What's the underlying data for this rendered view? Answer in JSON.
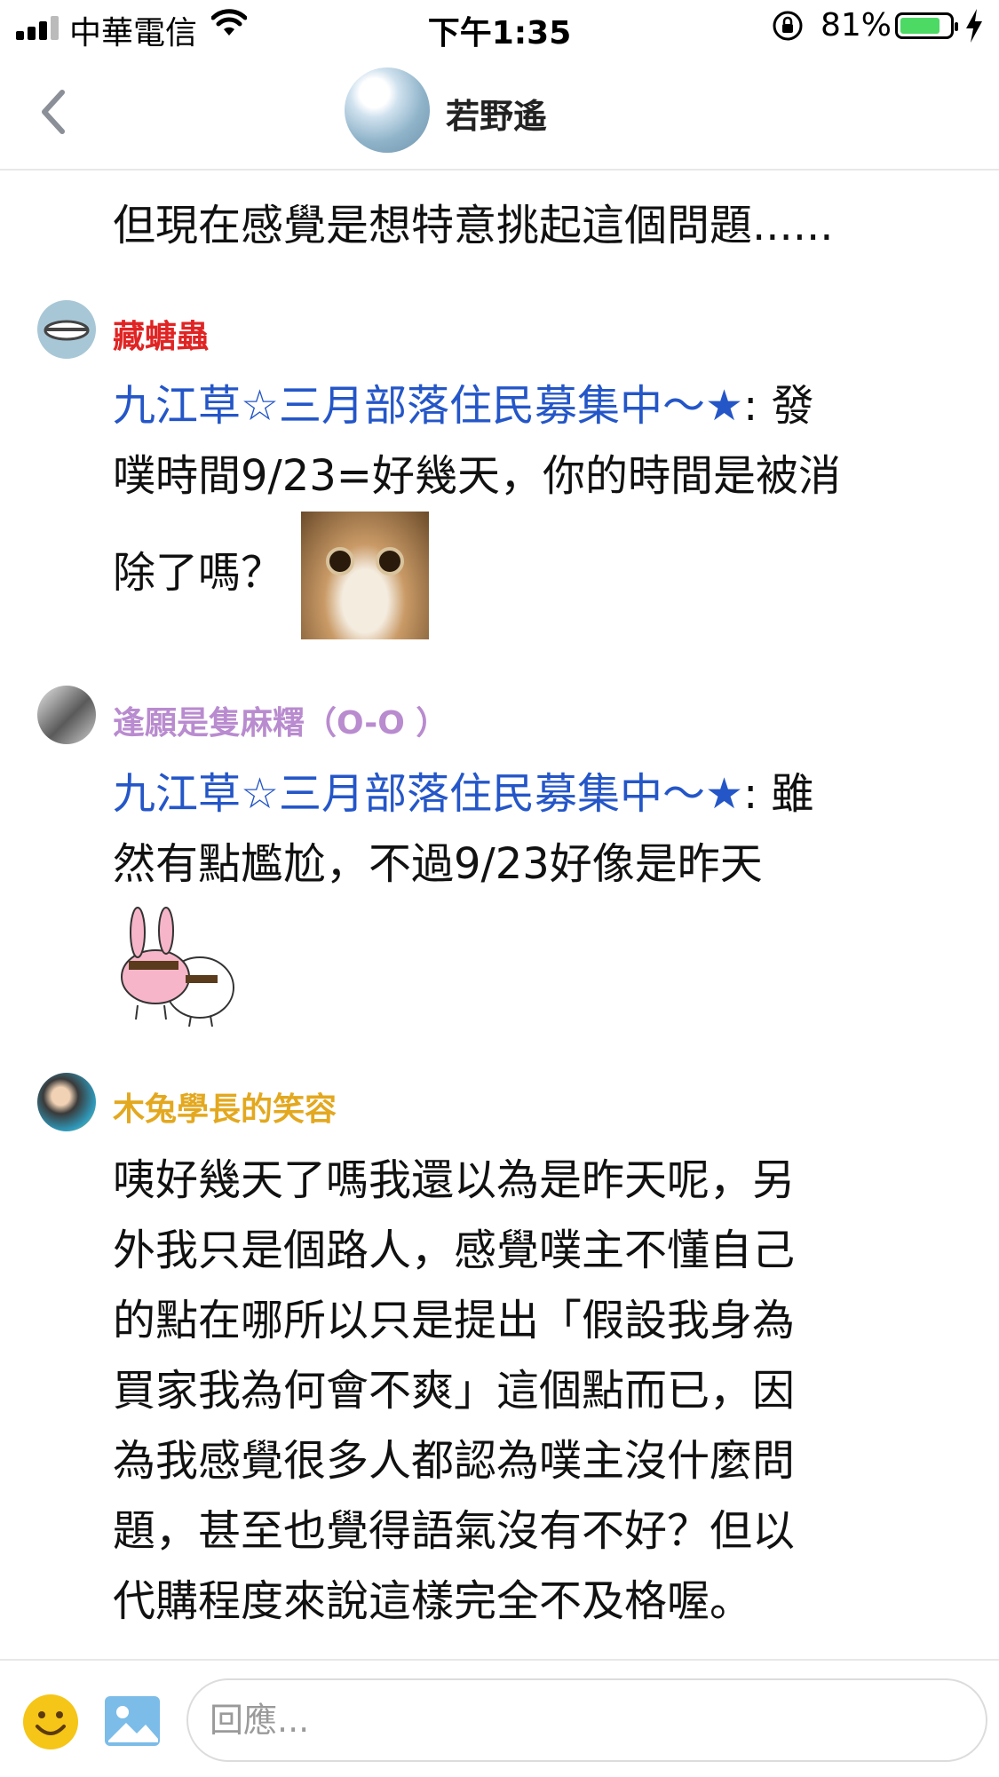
{
  "status_bar": {
    "carrier": "中華電信",
    "time": "下午1:35",
    "battery": "81%"
  },
  "header": {
    "title": "若野遙"
  },
  "messages": [
    {
      "text": "但現在感覺是想特意挑起這個問題......"
    },
    {
      "author": "藏螗蟲",
      "author_color": "#e02424",
      "mention": "九江草☆三月部落住民募集中～★",
      "text_lines": [
        ": 發",
        "噗時間9/23=好幾天，你的時間是被消",
        "除了嗎？"
      ]
    },
    {
      "author": "逢願是隻麻糬（O-O ）",
      "author_color": "#b98bcf",
      "mention": "九江草☆三月部落住民募集中～★",
      "text_lines": [
        ": 雖",
        "然有點尷尬，不過9/23好像是昨天"
      ]
    },
    {
      "author": "木兔學長的笑容",
      "author_color": "#e3a81f",
      "text_lines": [
        "咦好幾天了嗎我還以為是昨天呢，另",
        "外我只是個路人，感覺噗主不懂自己",
        "的點在哪所以只是提出「假設我身為",
        "買家我為何會不爽」這個點而已，因",
        "為我感覺很多人都認為噗主沒什麼問",
        "題，甚至也覺得語氣沒有不好？但以",
        "代購程度來說這樣完全不及格喔。"
      ]
    }
  ],
  "reply_bar": {
    "placeholder": "回應..."
  },
  "icons": {
    "emoji_color": "#f5c518",
    "image_color": "#7cbce8"
  }
}
